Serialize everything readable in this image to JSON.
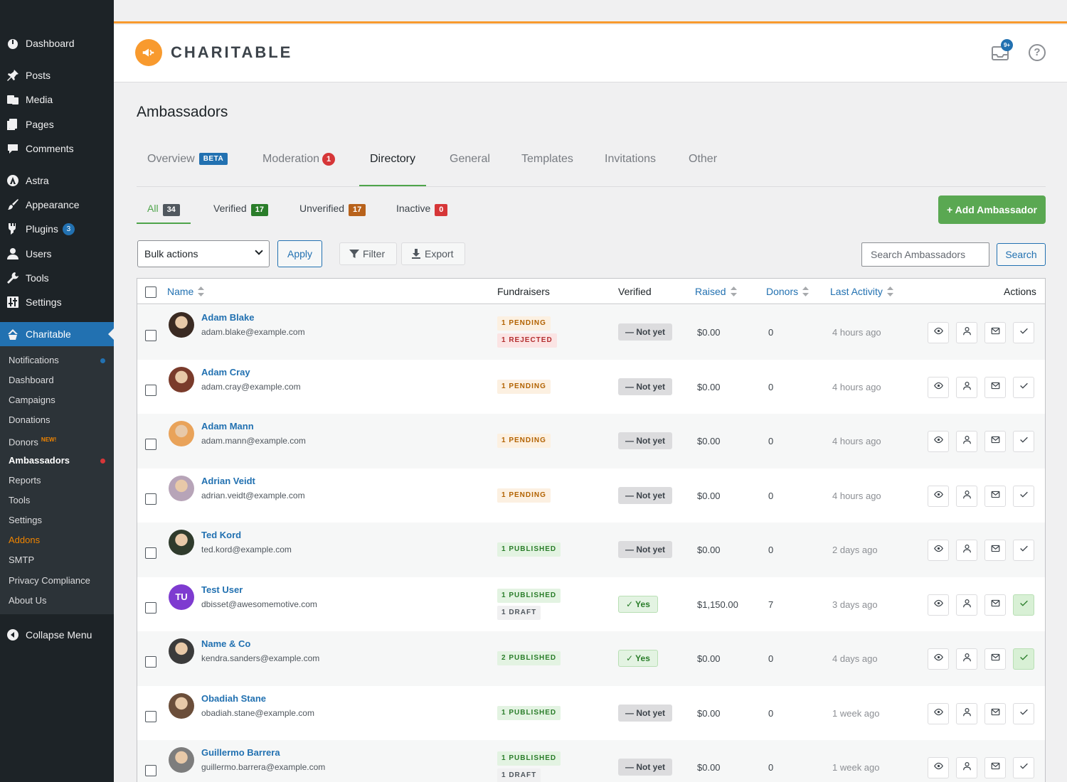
{
  "sidebar": {
    "menu": [
      {
        "label": "Dashboard",
        "icon": "dashboard-icon"
      },
      {
        "label": "Posts",
        "icon": "pin-icon"
      },
      {
        "label": "Media",
        "icon": "media-icon"
      },
      {
        "label": "Pages",
        "icon": "pages-icon"
      },
      {
        "label": "Comments",
        "icon": "comment-icon"
      },
      {
        "label": "Astra",
        "icon": "astra-icon"
      },
      {
        "label": "Appearance",
        "icon": "brush-icon"
      },
      {
        "label": "Plugins",
        "icon": "plug-icon",
        "badge": "3"
      },
      {
        "label": "Users",
        "icon": "user-icon"
      },
      {
        "label": "Tools",
        "icon": "wrench-icon"
      },
      {
        "label": "Settings",
        "icon": "sliders-icon"
      },
      {
        "label": "Charitable",
        "icon": "charitable-icon"
      }
    ],
    "submenu": [
      {
        "label": "Notifications",
        "dot": "#2271b1"
      },
      {
        "label": "Dashboard"
      },
      {
        "label": "Campaigns"
      },
      {
        "label": "Donations"
      },
      {
        "label": "Donors",
        "tag": "NEW!"
      },
      {
        "label": "Ambassadors",
        "dot": "#d63638"
      },
      {
        "label": "Reports"
      },
      {
        "label": "Tools"
      },
      {
        "label": "Settings"
      },
      {
        "label": "Addons"
      },
      {
        "label": "SMTP"
      },
      {
        "label": "Privacy Compliance"
      },
      {
        "label": "About Us"
      }
    ],
    "collapse_label": "Collapse Menu"
  },
  "header": {
    "brand": "CHARITABLE",
    "inbox_count": "9+",
    "help_label": "?"
  },
  "page": {
    "title": "Ambassadors",
    "tabs": [
      {
        "label": "Overview",
        "badge": "BETA"
      },
      {
        "label": "Moderation",
        "count": "1"
      },
      {
        "label": "Directory"
      },
      {
        "label": "General"
      },
      {
        "label": "Templates"
      },
      {
        "label": "Invitations"
      },
      {
        "label": "Other"
      }
    ],
    "filters": [
      {
        "label": "All",
        "count": "34",
        "color": "#50575e"
      },
      {
        "label": "Verified",
        "count": "17",
        "color": "#2a7d2a"
      },
      {
        "label": "Unverified",
        "count": "17",
        "color": "#b8621b"
      },
      {
        "label": "Inactive",
        "count": "0",
        "color": "#d63638"
      }
    ],
    "add_button": "+ Add Ambassador",
    "bulk_actions": "Bulk actions",
    "apply": "Apply",
    "filter": "Filter",
    "export": "Export",
    "search_placeholder": "Search Ambassadors",
    "search_button": "Search"
  },
  "table": {
    "columns": {
      "name": "Name",
      "fundraisers": "Fundraisers",
      "verified": "Verified",
      "raised": "Raised",
      "donors": "Donors",
      "last_activity": "Last Activity",
      "actions": "Actions"
    },
    "rows": [
      {
        "name": "Adam Blake",
        "email": "adam.blake@example.com",
        "avatar": "#3a2a22",
        "fundraisers": [
          {
            "t": "1 PENDING",
            "k": "pending"
          },
          {
            "t": "1 REJECTED",
            "k": "rejected"
          }
        ],
        "verified": "Not yet",
        "raised": "$0.00",
        "donors": "0",
        "activity": "4 hours ago"
      },
      {
        "name": "Adam Cray",
        "email": "adam.cray@example.com",
        "avatar": "#7a3b2b",
        "fundraisers": [
          {
            "t": "1 PENDING",
            "k": "pending"
          }
        ],
        "verified": "Not yet",
        "raised": "$0.00",
        "donors": "0",
        "activity": "4 hours ago"
      },
      {
        "name": "Adam Mann",
        "email": "adam.mann@example.com",
        "avatar": "#e9a35a",
        "fundraisers": [
          {
            "t": "1 PENDING",
            "k": "pending"
          }
        ],
        "verified": "Not yet",
        "raised": "$0.00",
        "donors": "0",
        "activity": "4 hours ago"
      },
      {
        "name": "Adrian Veidt",
        "email": "adrian.veidt@example.com",
        "avatar": "#b7a4b8",
        "fundraisers": [
          {
            "t": "1 PENDING",
            "k": "pending"
          }
        ],
        "verified": "Not yet",
        "raised": "$0.00",
        "donors": "0",
        "activity": "4 hours ago"
      },
      {
        "name": "Ted Kord",
        "email": "ted.kord@example.com",
        "avatar": "#2f3b2c",
        "fundraisers": [
          {
            "t": "1 PUBLISHED",
            "k": "published"
          }
        ],
        "verified": "Not yet",
        "raised": "$0.00",
        "donors": "0",
        "activity": "2 days ago"
      },
      {
        "name": "Test User",
        "email": "dbisset@awesomemotive.com",
        "initials": "TU",
        "fundraisers": [
          {
            "t": "1 PUBLISHED",
            "k": "published"
          },
          {
            "t": "1 DRAFT",
            "k": "draft"
          }
        ],
        "verified": "Yes",
        "raised": "$1,150.00",
        "donors": "7",
        "activity": "3 days ago"
      },
      {
        "name": "Name & Co",
        "email": "kendra.sanders@example.com",
        "avatar": "#3b3b3b",
        "fundraisers": [
          {
            "t": "2 PUBLISHED",
            "k": "published"
          }
        ],
        "verified": "Yes",
        "raised": "$0.00",
        "donors": "0",
        "activity": "4 days ago"
      },
      {
        "name": "Obadiah Stane",
        "email": "obadiah.stane@example.com",
        "avatar": "#6b4e3a",
        "fundraisers": [
          {
            "t": "1 PUBLISHED",
            "k": "published"
          }
        ],
        "verified": "Not yet",
        "raised": "$0.00",
        "donors": "0",
        "activity": "1 week ago"
      },
      {
        "name": "Guillermo Barrera",
        "email": "guillermo.barrera@example.com",
        "avatar": "#7d7d7d",
        "fundraisers": [
          {
            "t": "1 PUBLISHED",
            "k": "published"
          },
          {
            "t": "1 DRAFT",
            "k": "draft"
          }
        ],
        "verified": "Not yet",
        "raised": "$0.00",
        "donors": "0",
        "activity": "1 week ago"
      }
    ]
  }
}
